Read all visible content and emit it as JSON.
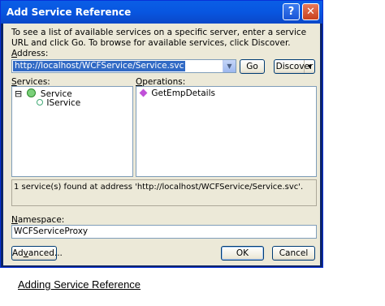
{
  "window": {
    "title": "Add Service Reference",
    "help_glyph": "?",
    "close_glyph": "✕"
  },
  "description": "To see a list of available services on a specific server, enter a service URL and click Go. To browse for available services, click Discover.",
  "address": {
    "label_prefix": "",
    "label_accel": "A",
    "label_rest": "ddress:",
    "value": "http://localhost/WCFService/Service.svc"
  },
  "buttons": {
    "go": "Go",
    "discover": "Discover",
    "discover_arrow": "▾",
    "advanced_accel": "v",
    "advanced_pre": "Ad",
    "advanced_post": "anced...",
    "ok": "OK",
    "cancel": "Cancel"
  },
  "services": {
    "label_accel": "S",
    "label_rest": "ervices:",
    "items": [
      {
        "label": "Service",
        "expander": "⊟",
        "icon": "globe-icon"
      },
      {
        "label": "IService",
        "icon": "interface-icon"
      }
    ]
  },
  "operations": {
    "label_prefix": "",
    "label_accel": "O",
    "label_rest": "perations:",
    "items": [
      {
        "label": "GetEmpDetails",
        "icon": "method-icon"
      }
    ]
  },
  "status_text": "1 service(s) found at address 'http://localhost/WCFService/Service.svc'.",
  "namespace": {
    "label_accel": "N",
    "label_rest": "amespace:",
    "value": "WCFServiceProxy"
  },
  "caption": "Adding Service Reference"
}
